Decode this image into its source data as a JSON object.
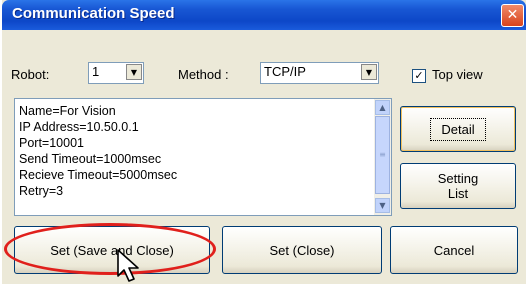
{
  "window": {
    "title": "Communication Speed",
    "close_icon": "close-icon"
  },
  "robot": {
    "label": "Robot:",
    "value": "1"
  },
  "method": {
    "label": "Method :",
    "value": "TCP/IP"
  },
  "top_view": {
    "label": "Top view",
    "checked": true
  },
  "info": {
    "lines": [
      "Name=For Vision",
      "IP Address=10.50.0.1",
      "Port=10001",
      "Send Timeout=1000msec",
      "Recieve Timeout=5000msec",
      "Retry=3"
    ]
  },
  "buttons": {
    "detail": "Detail",
    "setting_list_line1": "Setting",
    "setting_list_line2": "List",
    "set_save_close": "Set (Save and Close)",
    "set_close": "Set (Close)",
    "cancel": "Cancel"
  },
  "colors": {
    "titlebar": "#0d47c8",
    "highlight": "#e0201c",
    "dialog": "#ece9d8"
  }
}
